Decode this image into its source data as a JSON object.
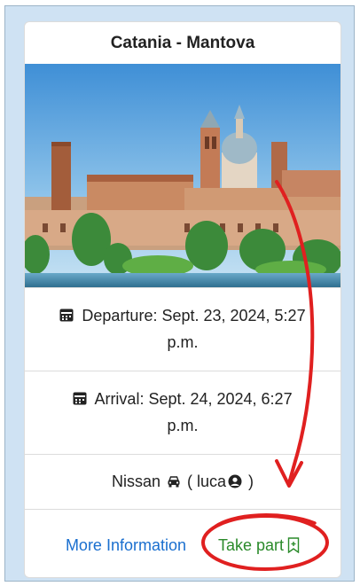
{
  "card": {
    "title": "Catania - Mantova",
    "image_icon": "city-skyline-photo",
    "departure": {
      "icon": "calendar-icon",
      "label": "Departure: Sept. 23, 2024, 5:27",
      "label_cont": "p.m."
    },
    "arrival": {
      "icon": "calendar-icon",
      "label": "Arrival: Sept. 24, 2024, 6:27",
      "label_cont": "p.m."
    },
    "vehicle": {
      "brand": "Nissan",
      "car_icon": "car-icon",
      "open": "( luca",
      "user_icon": "user-circle-icon",
      "close": " )"
    },
    "actions": {
      "more_info": "More Information",
      "take_part": "Take part",
      "take_part_icon": "bookmark-plus-icon"
    }
  },
  "colors": {
    "link_blue": "#1a6fcf",
    "link_green": "#2a8a2a",
    "annotation_red": "#e02020",
    "background": "#cfe2f3"
  }
}
